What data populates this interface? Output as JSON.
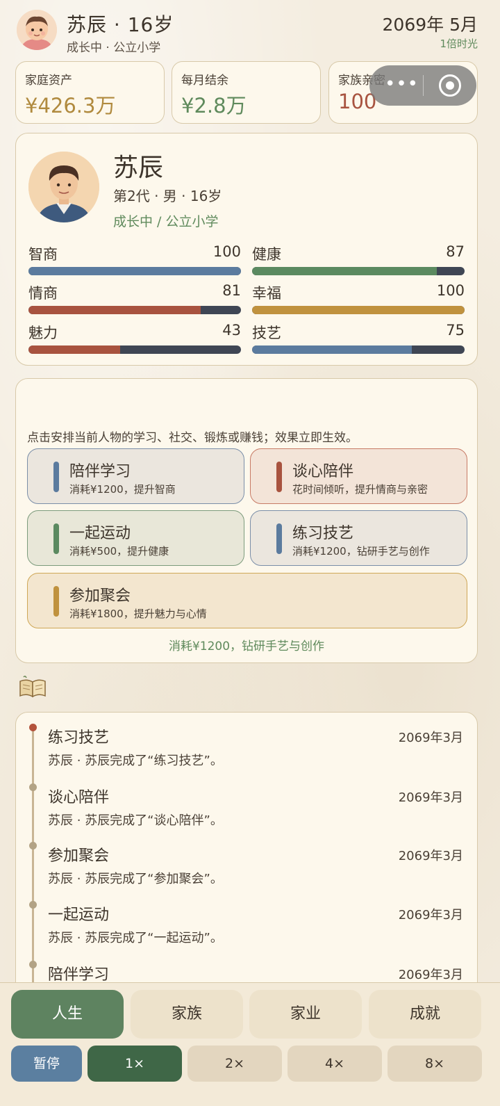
{
  "header": {
    "name_age": "苏辰 · 16岁",
    "status": "成长中 · 公立小学",
    "date": "2069年 5月",
    "speed_label": "1倍时光",
    "avatar_icon": "baby-avatar-icon"
  },
  "stats": [
    {
      "label": "家庭资产",
      "value": "¥426.3万",
      "color": "#b08a3e"
    },
    {
      "label": "每月结余",
      "value": "¥2.8万",
      "color": "#5f8a5c"
    },
    {
      "label": "家族亲密",
      "value": "100",
      "color": "#a8533f"
    }
  ],
  "capsule": {
    "more_icon": "more-dots-icon",
    "close_icon": "target-circle-icon"
  },
  "profile": {
    "name": "苏辰",
    "info": "第2代 · 男 · 16岁",
    "stage": "成长中 / 公立小学",
    "avatar_icon": "teen-avatar-icon",
    "attributes": [
      {
        "name": "智商",
        "value": 100,
        "percent": 100,
        "color": "#5b7b9e"
      },
      {
        "name": "健康",
        "value": 87,
        "percent": 87,
        "color": "#5b8a60"
      },
      {
        "name": "情商",
        "value": 81,
        "percent": 81,
        "color": "#a8533f"
      },
      {
        "name": "幸福",
        "value": 100,
        "percent": 100,
        "color": "#c0923e"
      },
      {
        "name": "魅力",
        "value": 43,
        "percent": 43,
        "color": "#a8533f"
      },
      {
        "name": "技艺",
        "value": 75,
        "percent": 75,
        "color": "#5b7b9e"
      }
    ]
  },
  "actions": {
    "hint": "点击安排当前人物的学习、社交、锻炼或赚钱；效果立即生效。",
    "items": [
      {
        "title": "陪伴学习",
        "desc": "消耗¥1200，提升智商",
        "bg": "#ebe6de",
        "border": "#7a8ea8",
        "stripe": "#5b7b9e"
      },
      {
        "title": "谈心陪伴",
        "desc": "花时间倾听，提升情商与亲密",
        "bg": "#f3e4d8",
        "border": "#c77a65",
        "stripe": "#a8533f"
      },
      {
        "title": "一起运动",
        "desc": "消耗¥500，提升健康",
        "bg": "#e8e7d8",
        "border": "#7c9b7c",
        "stripe": "#5b8a60"
      },
      {
        "title": "练习技艺",
        "desc": "消耗¥1200，钻研手艺与创作",
        "bg": "#ebe6de",
        "border": "#7a8ea8",
        "stripe": "#5b7b9e"
      },
      {
        "title": "参加聚会",
        "desc": "消耗¥1800，提升魅力与心情",
        "bg": "#f3e6cf",
        "border": "#cfa756",
        "stripe": "#c0923e"
      }
    ],
    "footer": "消耗¥1200，钻研手艺与创作"
  },
  "book_icon": "open-book-icon",
  "timeline": [
    {
      "title": "练习技艺",
      "date": "2069年3月",
      "desc": "苏辰 · 苏辰完成了“练习技艺”。"
    },
    {
      "title": "谈心陪伴",
      "date": "2069年3月",
      "desc": "苏辰 · 苏辰完成了“谈心陪伴”。"
    },
    {
      "title": "参加聚会",
      "date": "2069年3月",
      "desc": "苏辰 · 苏辰完成了“参加聚会”。"
    },
    {
      "title": "一起运动",
      "date": "2069年3月",
      "desc": "苏辰 · 苏辰完成了“一起运动”。"
    },
    {
      "title": "陪伴学习",
      "date": "2069年3月",
      "desc": ""
    }
  ],
  "tabs": [
    "人生",
    "家族",
    "家业",
    "成就"
  ],
  "speeds": [
    "暂停",
    "1×",
    "2×",
    "4×",
    "8×"
  ]
}
